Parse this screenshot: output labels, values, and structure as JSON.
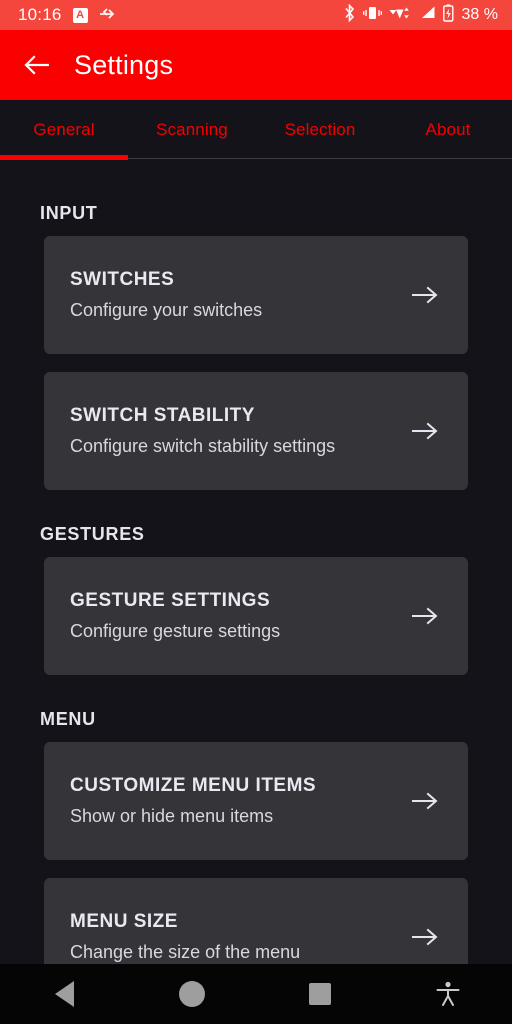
{
  "status_bar": {
    "time": "10:16",
    "battery_percent": "38 %",
    "icons": [
      "app-notification-a-icon",
      "shortcut-arrow-icon",
      "bluetooth-icon",
      "vibrate-icon",
      "wifi-icon",
      "signal-icon",
      "battery-charging-icon"
    ],
    "badge_letter": "A",
    "background_color": "#F4463C"
  },
  "app_bar": {
    "back_label": "back-arrow",
    "title": "Settings",
    "background_color": "#FA0000"
  },
  "tabs": {
    "items": [
      {
        "label": "General",
        "selected": true
      },
      {
        "label": "Scanning",
        "selected": false
      },
      {
        "label": "Selection",
        "selected": false
      },
      {
        "label": "About",
        "selected": false
      }
    ],
    "accent_color": "#FA0000"
  },
  "sections": [
    {
      "header": "INPUT",
      "items": [
        {
          "title": "SWITCHES",
          "subtitle": "Configure your switches"
        },
        {
          "title": "SWITCH STABILITY",
          "subtitle": "Configure switch stability settings"
        }
      ]
    },
    {
      "header": "GESTURES",
      "items": [
        {
          "title": "GESTURE SETTINGS",
          "subtitle": "Configure gesture settings"
        }
      ]
    },
    {
      "header": "MENU",
      "items": [
        {
          "title": "CUSTOMIZE MENU ITEMS",
          "subtitle": "Show or hide menu items"
        },
        {
          "title": "MENU SIZE",
          "subtitle": "Change the size of the menu"
        }
      ]
    }
  ],
  "nav_bar": {
    "buttons": [
      "back-triangle-icon",
      "home-circle-icon",
      "recents-square-icon",
      "accessibility-icon"
    ],
    "background_color": "#050505"
  },
  "theme": {
    "page_background": "#14131A",
    "card_background": "#343439",
    "primary_text": "#EAE8F0",
    "secondary_text": "#D9D7E0"
  }
}
